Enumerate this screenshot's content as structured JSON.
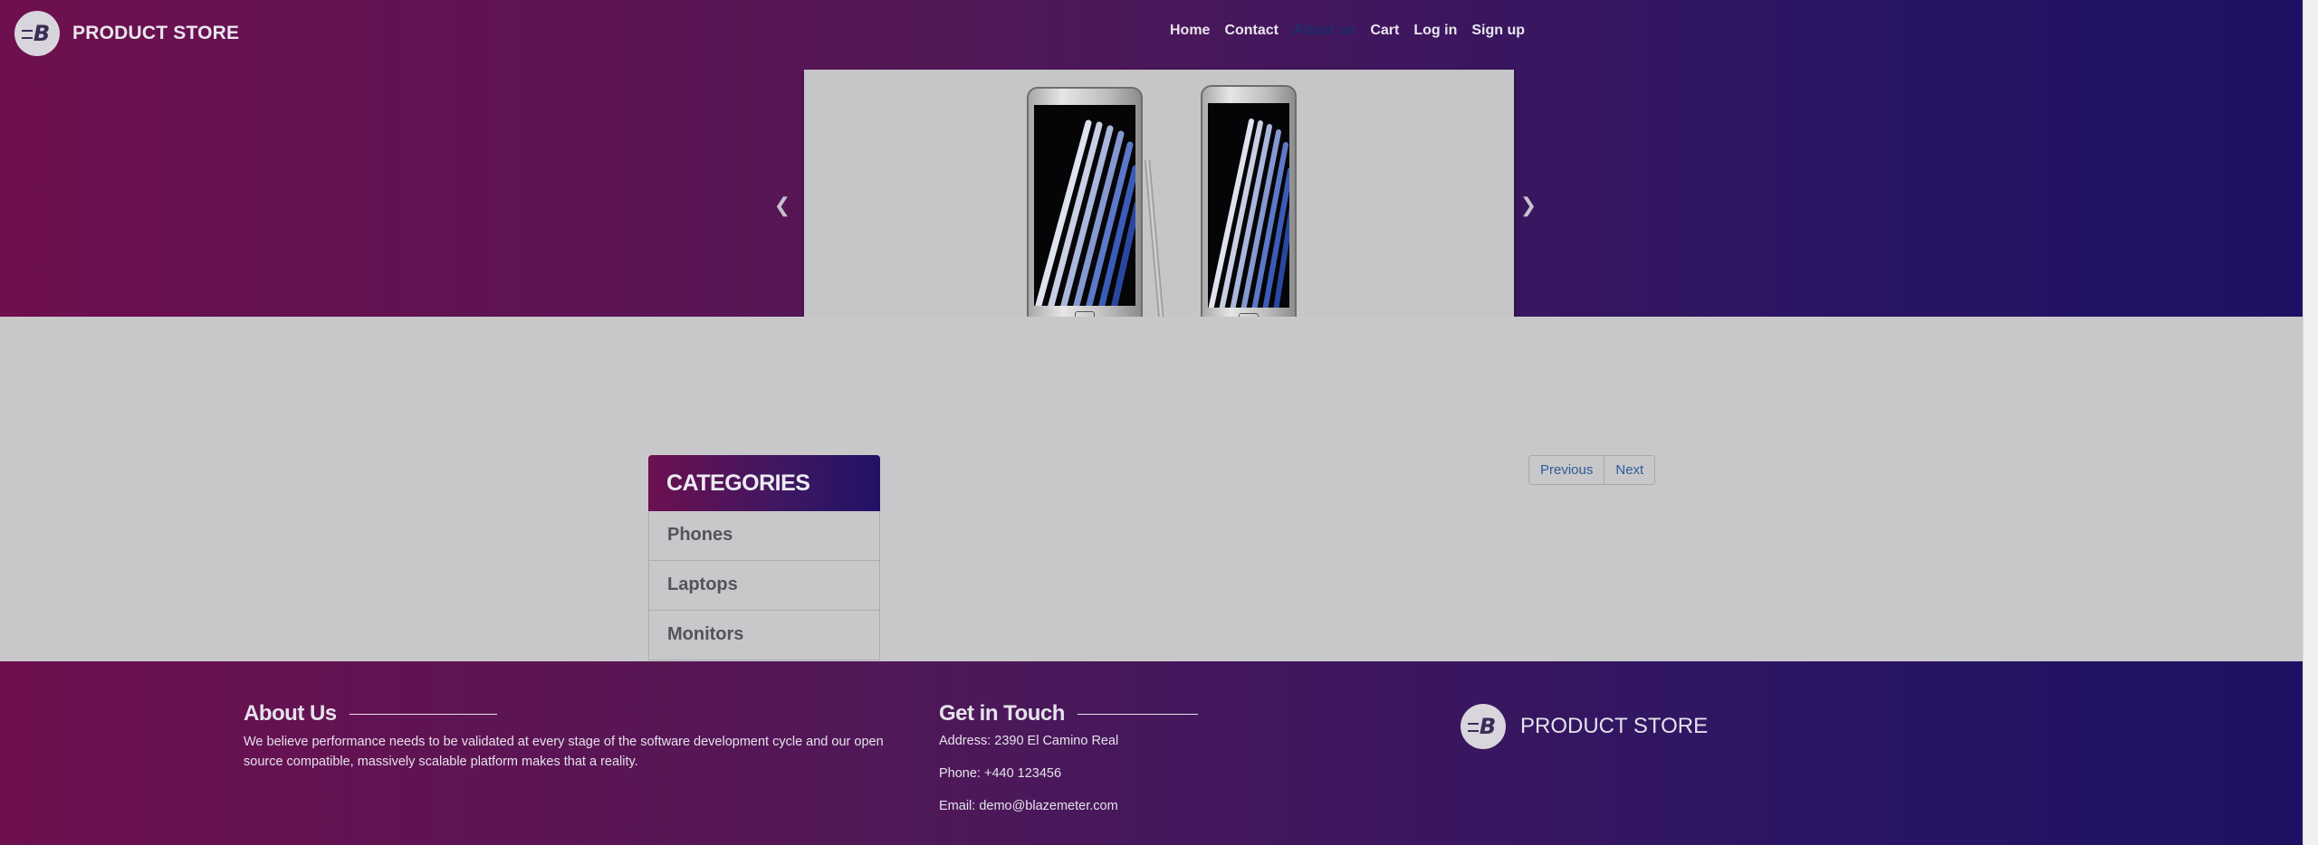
{
  "brand": {
    "name": "PRODUCT STORE",
    "logo_letter": "B"
  },
  "nav": {
    "items": [
      {
        "label": "Home"
      },
      {
        "label": "Contact"
      },
      {
        "label": "About us"
      },
      {
        "label": "Cart"
      },
      {
        "label": "Log in"
      },
      {
        "label": "Sign up"
      }
    ]
  },
  "carousel": {
    "prev_icon": "chevron-left-icon",
    "next_icon": "chevron-right-icon"
  },
  "categories": {
    "title": "CATEGORIES",
    "items": [
      {
        "label": "Phones"
      },
      {
        "label": "Laptops"
      },
      {
        "label": "Monitors"
      }
    ]
  },
  "pagination": {
    "previous_label": "Previous",
    "next_label": "Next"
  },
  "footer": {
    "about": {
      "title": "About Us",
      "text": "We believe performance needs to be validated at every stage of the software development cycle and our open source compatible, massively scalable platform makes that a reality."
    },
    "contact": {
      "title": "Get in Touch",
      "address": "Address: 2390 El Camino Real",
      "phone": "Phone: +440 123456",
      "email": "Email: demo@blazemeter.com"
    },
    "brand_name": "PRODUCT STORE"
  },
  "colors": {
    "gradient_start": "#6e0f4e",
    "gradient_end": "#1d1163",
    "page_bg": "#c8c8ca",
    "link_blue": "#2f5a98"
  }
}
